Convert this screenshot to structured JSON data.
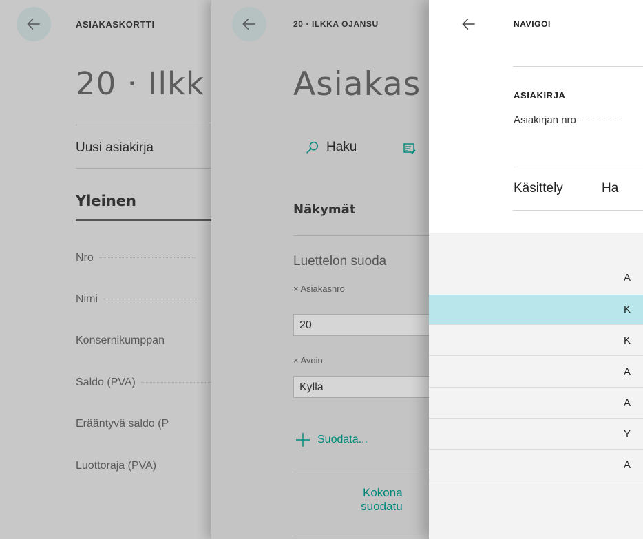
{
  "panel1": {
    "caption": "ASIAKASKORTTI",
    "title": "20 · Ilkk",
    "action": "Uusi asiakirja",
    "section_tab": "Yleinen",
    "fields": [
      {
        "label": "Nro"
      },
      {
        "label": "Nimi"
      },
      {
        "label": "Konsernikumppan"
      },
      {
        "label": "Saldo (PVA)"
      },
      {
        "label": "Erääntyvä saldo (P"
      },
      {
        "label": "Luottoraja (PVA)"
      }
    ]
  },
  "panel2": {
    "caption": "20 · ILKKA OJANSU",
    "title": "Asiakas",
    "search_label": "Haku",
    "views_heading": "Näkymät",
    "filter_heading": "Luettelon suoda",
    "filters": [
      {
        "name": "Asiakasnro",
        "value": "20"
      },
      {
        "name": "Avoin",
        "value": "Kyllä"
      }
    ],
    "add_filter_label": "Suodata...",
    "totals_line1": "Kokona",
    "totals_line2": "suodatu"
  },
  "panel3": {
    "caption": "NAVIGOI",
    "section_caption": "ASIAKIRJA",
    "doc_no_label": "Asiakirjan nro",
    "tabs": [
      "Käsittely",
      "Ha"
    ],
    "list_header": "A",
    "rows": [
      "K",
      "K",
      "A",
      "A",
      "Y",
      "A"
    ],
    "selected_row": 0,
    "selected_color": "#b9e6ea"
  },
  "icons": {
    "back": "back-arrow-icon",
    "search": "search-icon",
    "edit": "edit-list-icon",
    "plus": "plus-icon",
    "remove": "remove-filter-icon"
  },
  "colors": {
    "accent_teal": "#00897b",
    "back_button": "#b6c2c2"
  }
}
